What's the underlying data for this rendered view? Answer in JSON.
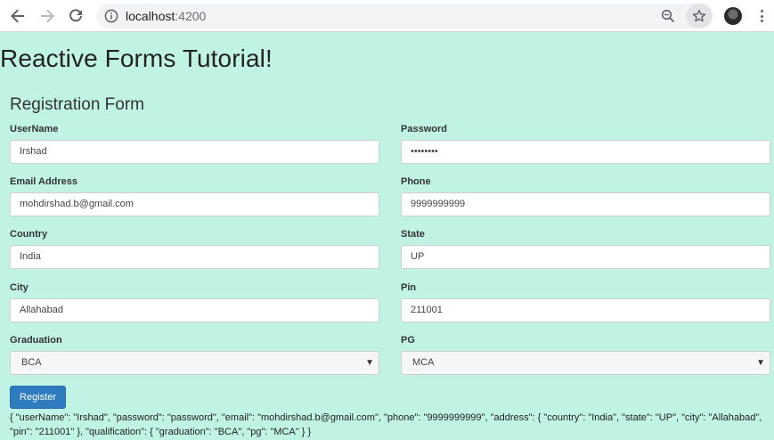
{
  "browser": {
    "url_host": "localhost",
    "url_port": ":4200",
    "icons": [
      "back-arrow-icon",
      "forward-arrow-icon",
      "reload-icon",
      "info-icon",
      "zoom-out-icon",
      "star-icon",
      "avatar",
      "more-vert-icon"
    ]
  },
  "page": {
    "title": "Reactive Forms Tutorial!",
    "form_title": "Registration Form"
  },
  "form": {
    "username": {
      "label": "UserName",
      "value": "Irshad"
    },
    "password": {
      "label": "Password",
      "value": "••••••••"
    },
    "email": {
      "label": "Email Address",
      "value": "mohdirshad.b@gmail.com"
    },
    "phone": {
      "label": "Phone",
      "value": "9999999999"
    },
    "country": {
      "label": "Country",
      "value": "India"
    },
    "state": {
      "label": "State",
      "value": "UP"
    },
    "city": {
      "label": "City",
      "value": "Allahabad"
    },
    "pin": {
      "label": "Pin",
      "value": "211001"
    },
    "graduation": {
      "label": "Graduation",
      "value": "BCA"
    },
    "pg": {
      "label": "PG",
      "value": "MCA"
    },
    "submit_label": "Register"
  },
  "output": {
    "json_text": "{ \"userName\": \"Irshad\", \"password\": \"password\", \"email\": \"mohdirshad.b@gmail.com\", \"phone\": \"9999999999\", \"address\": { \"country\": \"India\", \"state\": \"UP\", \"city\": \"Allahabad\", \"pin\": \"211001\" }, \"qualification\": { \"graduation\": \"BCA\", \"pg\": \"MCA\" } }"
  },
  "colors": {
    "page_background": "#c1f3e4",
    "button_primary": "#2e7bc0"
  }
}
